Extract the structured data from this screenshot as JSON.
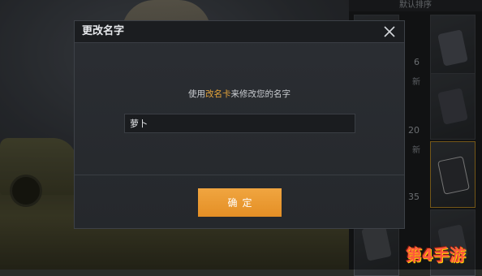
{
  "inventory": {
    "sort_label": "默认排序",
    "counts": [
      "6",
      "20",
      "35"
    ],
    "tags": [
      "新",
      "新"
    ]
  },
  "dialog": {
    "title": "更改名字",
    "hint_prefix": "使用",
    "hint_highlight": "改名卡",
    "hint_suffix": "来修改您的名字",
    "input_value": "萝卜",
    "confirm_label": "确定"
  },
  "watermark": {
    "text": "第4手游"
  },
  "colors": {
    "accent": "#e89a2e",
    "highlight_text": "#e6a53a",
    "dialog_bg": "#2b2e33",
    "header_bg": "#1b1d20"
  },
  "icons": {
    "close": "close-icon"
  }
}
